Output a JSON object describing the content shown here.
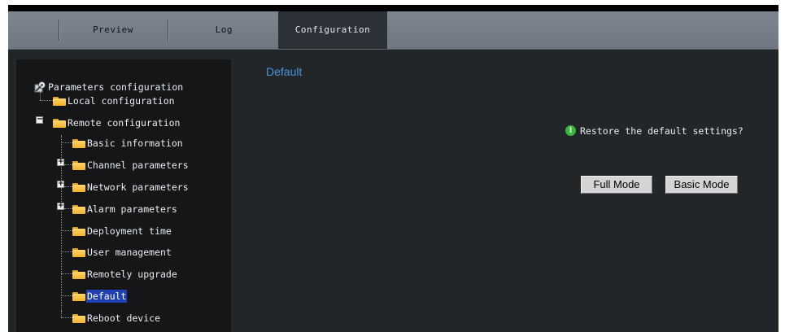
{
  "nav": {
    "tabs": [
      {
        "label": "Preview"
      },
      {
        "label": "Log"
      },
      {
        "label": "Configuration"
      }
    ],
    "active_tab": "Configuration"
  },
  "sidebar": {
    "root_label": "Parameters configuration",
    "items": [
      {
        "label": "Local configuration"
      },
      {
        "label": "Remote configuration"
      },
      {
        "label": "Basic information"
      },
      {
        "label": "Channel parameters"
      },
      {
        "label": "Network parameters"
      },
      {
        "label": "Alarm parameters"
      },
      {
        "label": "Deployment time"
      },
      {
        "label": "User management"
      },
      {
        "label": "Remotely upgrade"
      },
      {
        "label": "Default"
      },
      {
        "label": "Reboot device"
      }
    ],
    "expand_symbols": {
      "collapsed": "+",
      "expanded": "−"
    }
  },
  "main": {
    "title": "Default",
    "prompt": "Restore the default settings?",
    "info_symbol": "!",
    "full_mode_label": "Full Mode",
    "basic_mode_label": "Basic Mode"
  },
  "colors": {
    "accent_title": "#4a94dd",
    "selection": "#1f3fb2",
    "info_green": "#37b83a",
    "folder_yellow": "#f3b12b"
  }
}
